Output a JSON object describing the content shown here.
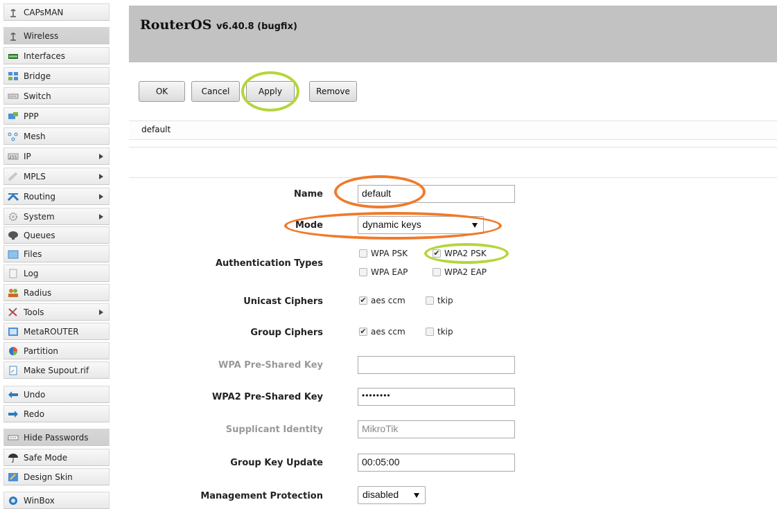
{
  "sidebar": {
    "items": [
      {
        "label": "CAPsMAN",
        "icon": "antenna-icon",
        "arrow": false
      },
      {
        "label": "Wireless",
        "icon": "antenna-icon",
        "arrow": false,
        "active": true
      },
      {
        "label": "Interfaces",
        "icon": "interfaces-icon",
        "arrow": false
      },
      {
        "label": "Bridge",
        "icon": "bridge-icon",
        "arrow": false
      },
      {
        "label": "Switch",
        "icon": "switch-icon",
        "arrow": false
      },
      {
        "label": "PPP",
        "icon": "ppp-icon",
        "arrow": false
      },
      {
        "label": "Mesh",
        "icon": "mesh-icon",
        "arrow": false
      },
      {
        "label": "IP",
        "icon": "ip-icon",
        "arrow": true
      },
      {
        "label": "MPLS",
        "icon": "mpls-icon",
        "arrow": true
      },
      {
        "label": "Routing",
        "icon": "routing-icon",
        "arrow": true
      },
      {
        "label": "System",
        "icon": "gear-icon",
        "arrow": true
      },
      {
        "label": "Queues",
        "icon": "queues-icon",
        "arrow": false
      },
      {
        "label": "Files",
        "icon": "folder-icon",
        "arrow": false
      },
      {
        "label": "Log",
        "icon": "log-icon",
        "arrow": false
      },
      {
        "label": "Radius",
        "icon": "users-icon",
        "arrow": false
      },
      {
        "label": "Tools",
        "icon": "tools-icon",
        "arrow": true
      },
      {
        "label": "MetaROUTER",
        "icon": "metarouter-icon",
        "arrow": false
      },
      {
        "label": "Partition",
        "icon": "pie-icon",
        "arrow": false
      },
      {
        "label": "Make Supout.rif",
        "icon": "document-icon",
        "arrow": false
      },
      {
        "label": "Undo",
        "icon": "undo-icon",
        "arrow": false
      },
      {
        "label": "Redo",
        "icon": "redo-icon",
        "arrow": false
      },
      {
        "label": "Hide Passwords",
        "icon": "password-icon",
        "arrow": false
      },
      {
        "label": "Safe Mode",
        "icon": "umbrella-icon",
        "arrow": false
      },
      {
        "label": "Design Skin",
        "icon": "skin-icon",
        "arrow": false
      },
      {
        "label": "WinBox",
        "icon": "winbox-icon",
        "arrow": false
      }
    ]
  },
  "header": {
    "title": "RouterOS",
    "version": "v6.40.8 (bugfix)"
  },
  "toolbar": {
    "ok": "OK",
    "cancel": "Cancel",
    "apply": "Apply",
    "remove": "Remove"
  },
  "breadcrumb": "default",
  "form": {
    "name": {
      "label": "Name",
      "value": "default"
    },
    "mode": {
      "label": "Mode",
      "value": "dynamic keys"
    },
    "auth_types": {
      "label": "Authentication Types",
      "options": [
        {
          "label": "WPA PSK",
          "checked": false
        },
        {
          "label": "WPA2 PSK",
          "checked": true
        },
        {
          "label": "WPA EAP",
          "checked": false
        },
        {
          "label": "WPA2 EAP",
          "checked": false
        }
      ]
    },
    "unicast": {
      "label": "Unicast Ciphers",
      "options": [
        {
          "label": "aes ccm",
          "checked": true
        },
        {
          "label": "tkip",
          "checked": false
        }
      ]
    },
    "group": {
      "label": "Group Ciphers",
      "options": [
        {
          "label": "aes ccm",
          "checked": true
        },
        {
          "label": "tkip",
          "checked": false
        }
      ]
    },
    "wpa_key": {
      "label": "WPA Pre-Shared Key",
      "value": ""
    },
    "wpa2_key": {
      "label": "WPA2 Pre-Shared Key",
      "value": "••••••••"
    },
    "supplicant": {
      "label": "Supplicant Identity",
      "value": "MikroTik"
    },
    "group_key_update": {
      "label": "Group Key Update",
      "value": "00:05:00"
    },
    "mgmt": {
      "label": "Management Protection",
      "value": "disabled"
    }
  },
  "colors": {
    "annotation_orange": "#f07a2a",
    "annotation_green": "#b4d63a",
    "header_bg": "#c2c2c2"
  }
}
